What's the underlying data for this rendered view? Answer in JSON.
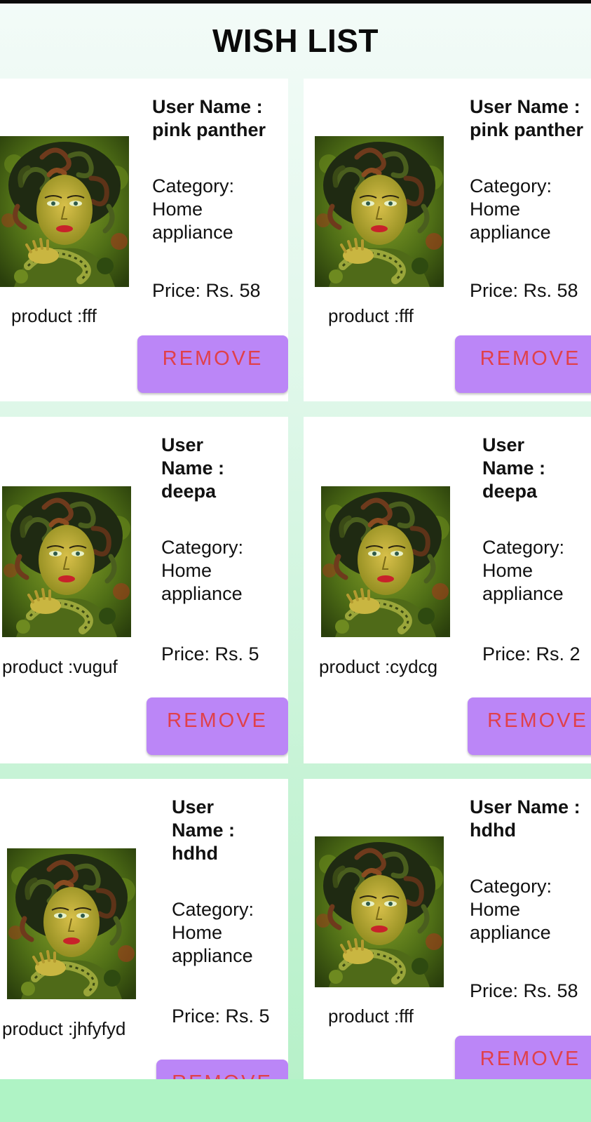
{
  "header": {
    "title": "WISH LIST"
  },
  "items": [
    {
      "user": "User Name : pink panther",
      "category": "Category: Home appliance",
      "price": "Price: Rs. 58",
      "product": "product :fff",
      "button_label": "REMOVE"
    },
    {
      "user": "User Name : pink panther",
      "category": "Category: Home appliance",
      "price": "Price: Rs. 58",
      "product": "product :fff",
      "button_label": "REMOVE"
    },
    {
      "user": "User Name : deepa",
      "category": "Category: Home appliance",
      "price": "Price: Rs. 5",
      "product": "product :vuguf",
      "button_label": "REMOVE"
    },
    {
      "user": "User Name : deepa",
      "category": "Category: Home appliance",
      "price": "Price: Rs. 2",
      "product": "product :cydcg",
      "button_label": "REMOVE"
    },
    {
      "user": "User Name : hdhd",
      "category": "Category: Home appliance",
      "price": "Price: Rs. 5",
      "product": "product :jhfyfyd",
      "button_label": "REMOVE"
    },
    {
      "user": "User Name : hdhd",
      "category": "Category: Home appliance",
      "price": "Price: Rs. 58",
      "product": "product :fff",
      "button_label": "REMOVE"
    }
  ],
  "colors": {
    "card_background": "#ffffff",
    "button_background": "#bb86f7",
    "button_text": "#e0404a",
    "page_background": "#c7f3d6"
  }
}
